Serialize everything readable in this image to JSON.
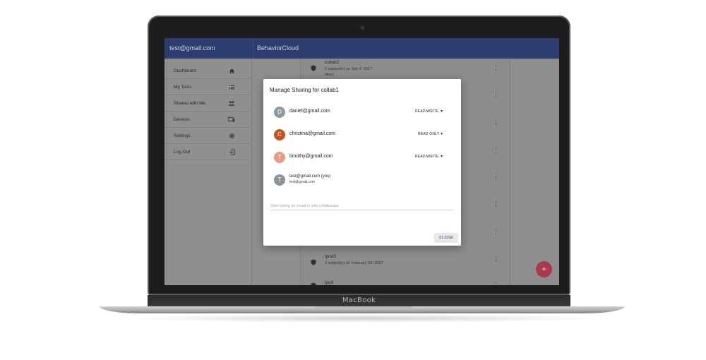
{
  "device": {
    "brand": "MacBook"
  },
  "appbar": {
    "account": "test@gmail.com",
    "title": "BehaviorCloud"
  },
  "drawer": {
    "items": [
      {
        "label": "Dashboard",
        "icon": "home-icon"
      },
      {
        "label": "My Tests",
        "icon": "list-icon"
      },
      {
        "label": "Shared with Me",
        "icon": "people-icon"
      },
      {
        "label": "Devices",
        "icon": "devices-icon"
      },
      {
        "label": "Settings",
        "icon": "gear-icon"
      },
      {
        "label": "Log Out",
        "icon": "exit-icon"
      }
    ]
  },
  "list": {
    "rows": [
      {
        "name": "collab2",
        "meta": "5 subject(s) on July 4, 2017",
        "sub": "desc1"
      },
      {
        "name": "ipod2",
        "meta": "3 subject(s) on February 24, 2017",
        "sub": ""
      },
      {
        "name": "ipod",
        "meta": "",
        "sub": ""
      }
    ]
  },
  "dialog": {
    "title": "Manage Sharing for collab1",
    "collaborators": [
      {
        "initial": "D",
        "email": "daniel@gmail.com",
        "permission": "READ/WRITE",
        "color": "#8b9a9f"
      },
      {
        "initial": "C",
        "email": "christina@gmail.com",
        "permission": "READ ONLY",
        "color": "#c2521f"
      },
      {
        "initial": "T",
        "email": "timothy@gmail.com",
        "permission": "READ/WRITE",
        "color": "#e89a87"
      }
    ],
    "owner": {
      "initial": "T",
      "name": "test@gmail.com (you)",
      "email": "test@gmail.com",
      "color": "#8a9498"
    },
    "add_placeholder": "Start typing an email to add collaborator",
    "close_label": "CLOSE"
  },
  "colors": {
    "appbar": "#2d3d70",
    "fab": "#a93a4c",
    "accent": "#2d3d70"
  }
}
